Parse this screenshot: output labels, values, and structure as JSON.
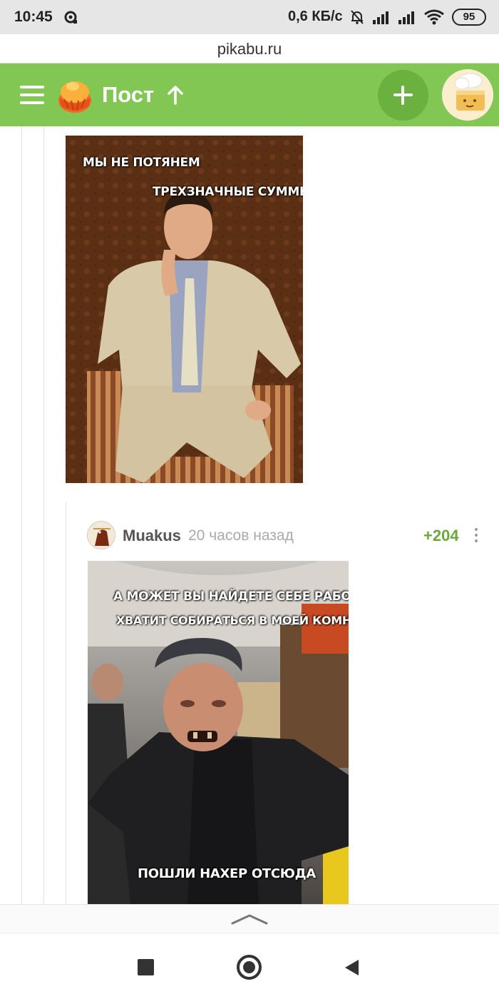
{
  "status_bar": {
    "time": "10:45",
    "net_speed": "0,6 КБ/с",
    "battery": "95",
    "icons": [
      "notification-icon",
      "dnd-muted-icon",
      "signal-icon",
      "signal-icon",
      "wifi-icon",
      "battery-icon"
    ]
  },
  "browser": {
    "url": "pikabu.ru"
  },
  "header": {
    "title": "Пост",
    "accent": "#82c654",
    "icons": [
      "menu-icon",
      "pikabu-logo-icon",
      "arrow-up-icon",
      "plus-icon",
      "user-avatar"
    ]
  },
  "post_image": {
    "caption_line1": "МЫ НЕ ПОТЯНЕМ",
    "caption_line2": "ТРЕХЗНАЧНЫЕ СУММЫ."
  },
  "comment": {
    "author": "Muakus",
    "time": "20 часов назад",
    "rating": "+204",
    "rating_color": "#6aa83c",
    "image": {
      "caption_line1": "А МОЖЕТ ВЫ НАЙДЕТЕ СЕБЕ РАБОТУ",
      "caption_line2": "ХВАТИТ СОБИРАТЬСЯ В МОЕЙ КОМНАТЕ",
      "caption_bottom": "ПОШЛИ НАХЕР ОТСЮДА"
    }
  },
  "navigation": {
    "icons": [
      "recent-apps-icon",
      "home-icon",
      "back-icon"
    ]
  }
}
